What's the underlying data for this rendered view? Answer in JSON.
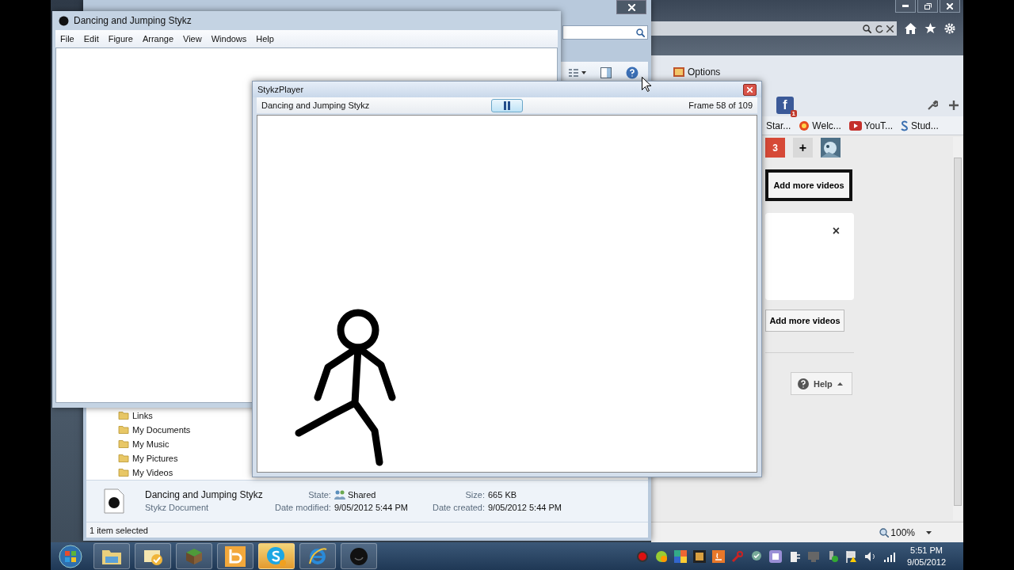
{
  "editor": {
    "title": "Dancing and Jumping Stykz",
    "menu": [
      "File",
      "Edit",
      "Figure",
      "Arrange",
      "View",
      "Windows",
      "Help"
    ]
  },
  "player": {
    "title": "StykzPlayer",
    "movie_title": "Dancing and Jumping Stykz",
    "frame": "Frame 58 of 109"
  },
  "explorer": {
    "nav_items": [
      "Links",
      "My Documents",
      "My Music",
      "My Pictures",
      "My Videos"
    ],
    "details": {
      "file_name": "Dancing and Jumping Stykz",
      "file_type": "Stykz Document",
      "fields": [
        {
          "label": "State:",
          "value": "Shared"
        },
        {
          "label": "Size:",
          "value": "665 KB"
        },
        {
          "label": "Date modified:",
          "value": "9/05/2012 5:44 PM"
        },
        {
          "label": "Date created:",
          "value": "9/05/2012 5:44 PM"
        }
      ]
    },
    "status": "1 item selected"
  },
  "browser": {
    "options": "Options",
    "facebook_mark": "f",
    "notification_count": "1",
    "bookmarks": [
      "Star...",
      "Welc...",
      "YouT...",
      "Stud..."
    ],
    "page": {
      "badge": "3",
      "add_button": "+",
      "primary_action": "Add more videos",
      "close_mark": "×",
      "secondary_action": "Add more videos",
      "help": "Help"
    },
    "zoom": "100%"
  },
  "taskbar": {
    "apps": [
      {
        "kind": "explorer",
        "flashing": false
      },
      {
        "kind": "mail",
        "flashing": false
      },
      {
        "kind": "block",
        "flashing": false
      },
      {
        "kind": "bing",
        "flashing": false
      },
      {
        "kind": "skype",
        "flashing": true
      },
      {
        "kind": "ie",
        "flashing": false
      },
      {
        "kind": "stykz",
        "flashing": false
      }
    ],
    "time": "5:51 PM",
    "date": "9/05/2012"
  }
}
